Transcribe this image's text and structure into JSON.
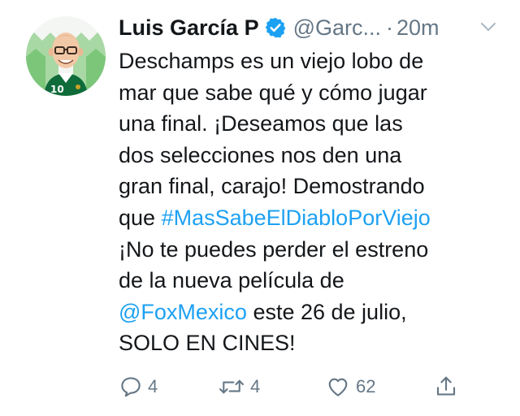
{
  "tweet": {
    "author": {
      "name": "Luis García P",
      "handle": "@Garc...",
      "verified": true,
      "avatar_icon": "avatar-illustration-icon"
    },
    "separator": "·",
    "time": "20m",
    "body": {
      "line1": "Deschamps es un viejo lobo de",
      "line2": "mar que sabe qué y cómo jugar",
      "line3": "una final. ¡Deseamos que las",
      "line4": "dos selecciones nos den una",
      "line5": "gran final, carajo! Demostrando",
      "line6_prefix": "que ",
      "hashtag": "#MasSabeElDiabloPorViejo",
      "line7": "¡No te puedes perder el estreno",
      "line8": "de la nueva película de",
      "mention": "@FoxMexico",
      "line9_suffix": " este 26 de julio,",
      "line10": "SOLO EN CINES!"
    },
    "actions": {
      "reply": {
        "icon": "reply-icon",
        "count": "4"
      },
      "retweet": {
        "icon": "retweet-icon",
        "count": "4"
      },
      "like": {
        "icon": "heart-icon",
        "count": "62"
      },
      "share": {
        "icon": "share-icon"
      }
    },
    "colors": {
      "link": "#1da1f2",
      "verified": "#1da1f2",
      "muted": "#657786",
      "text": "#14171a"
    }
  }
}
